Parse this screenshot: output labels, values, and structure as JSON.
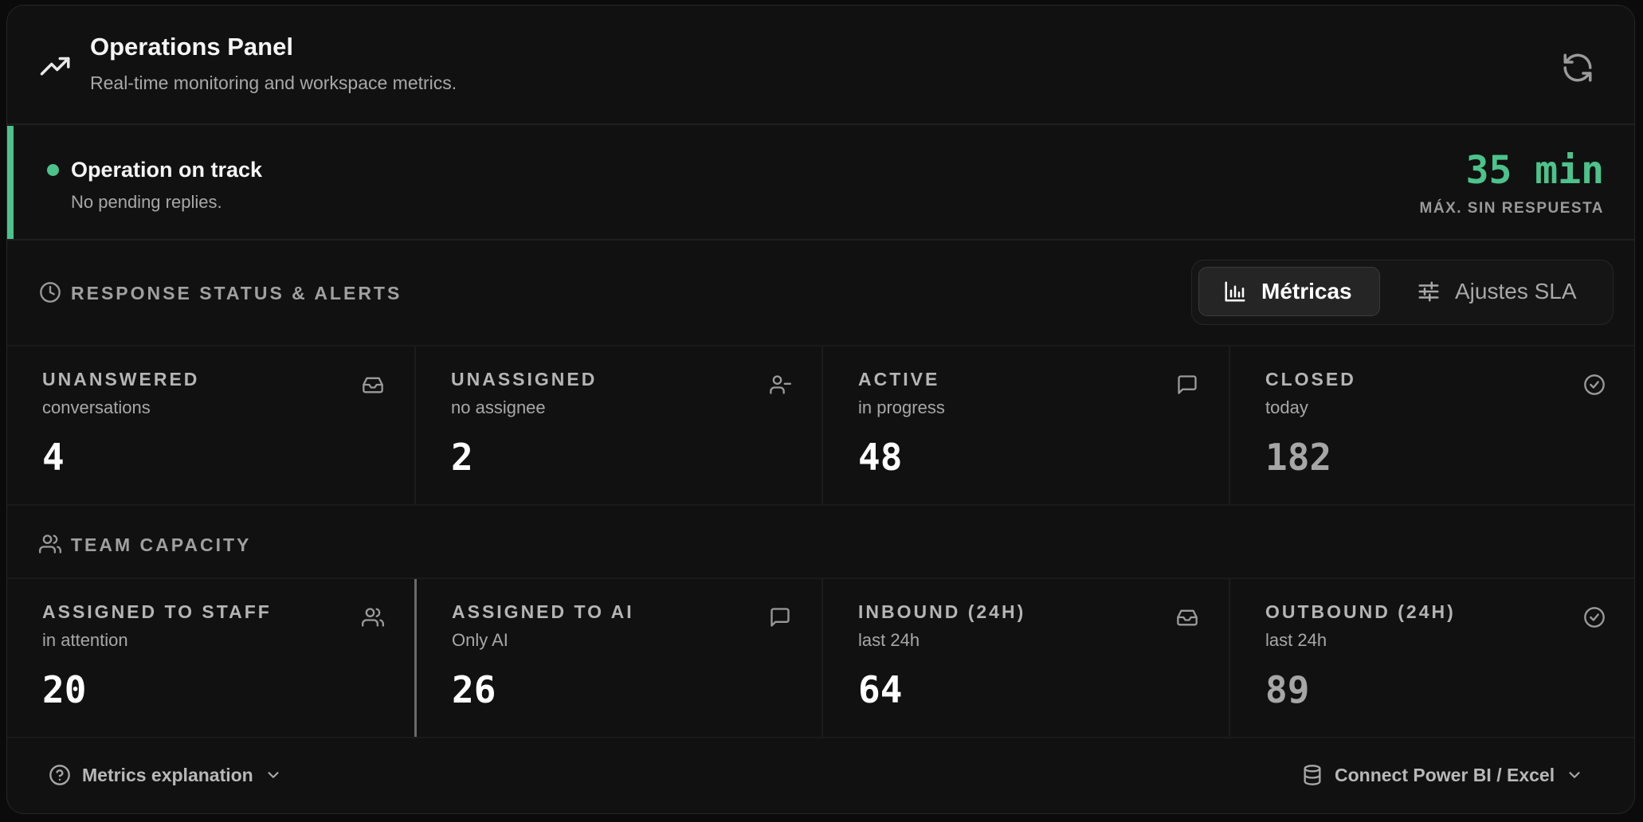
{
  "header": {
    "title": "Operations Panel",
    "subtitle": "Real-time monitoring and workspace metrics.",
    "refresh_icon": "refresh-icon"
  },
  "status": {
    "title": "Operation on track",
    "subtitle": "No pending replies.",
    "value": "35 min",
    "value_label": "MÁX. SIN RESPUESTA",
    "color": "#4cc38a"
  },
  "response_section": {
    "title": "RESPONSE STATUS & ALERTS",
    "icon": "clock-icon"
  },
  "view_toggle": {
    "metrics_label": "Métricas",
    "sla_label": "Ajustes SLA",
    "selected": "Métricas"
  },
  "response_cards": [
    {
      "label": "UNANSWERED",
      "sub": "conversations",
      "value": "4",
      "icon": "inbox-icon"
    },
    {
      "label": "UNASSIGNED",
      "sub": "no assignee",
      "value": "2",
      "icon": "user-minus-icon"
    },
    {
      "label": "ACTIVE",
      "sub": "in progress",
      "value": "48",
      "icon": "message-icon"
    },
    {
      "label": "CLOSED",
      "sub": "today",
      "value": "182",
      "icon": "check-circle-icon"
    }
  ],
  "capacity_section": {
    "title": "TEAM CAPACITY",
    "icon": "users-icon"
  },
  "capacity_cards": [
    {
      "label": "ASSIGNED TO STAFF",
      "sub": "in attention",
      "value": "20",
      "icon": "users-icon"
    },
    {
      "label": "ASSIGNED TO AI",
      "sub": "Only AI",
      "value": "26",
      "icon": "message-icon"
    },
    {
      "label": "INBOUND (24H)",
      "sub": "last 24h",
      "value": "64",
      "icon": "inbox-icon"
    },
    {
      "label": "OUTBOUND (24H)",
      "sub": "last 24h",
      "value": "89",
      "icon": "check-circle-icon"
    }
  ],
  "footer": {
    "explain_label": "Metrics explanation",
    "connect_label": "Connect Power BI / Excel"
  }
}
